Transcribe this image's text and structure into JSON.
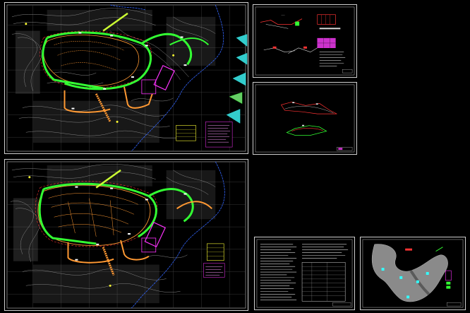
{
  "canvas": {
    "background": "#000000"
  },
  "colors": {
    "frame": "#cfcfcf",
    "contour": "#9a9a9a",
    "green": "#33ff33",
    "orange": "#ff9933",
    "red": "#ff3333",
    "magenta": "#ff33ff",
    "cyan": "#33ffff",
    "yellow": "#ffff33",
    "blue": "#3366ff",
    "white": "#ffffff"
  },
  "sheets": [
    {
      "id": "plan-top",
      "kind": "site-plan"
    },
    {
      "id": "plan-bottom",
      "kind": "site-plan"
    },
    {
      "id": "detail-sections",
      "kind": "sections"
    },
    {
      "id": "profile",
      "kind": "profile"
    },
    {
      "id": "notes",
      "kind": "notes"
    },
    {
      "id": "location-map",
      "kind": "map"
    }
  ]
}
